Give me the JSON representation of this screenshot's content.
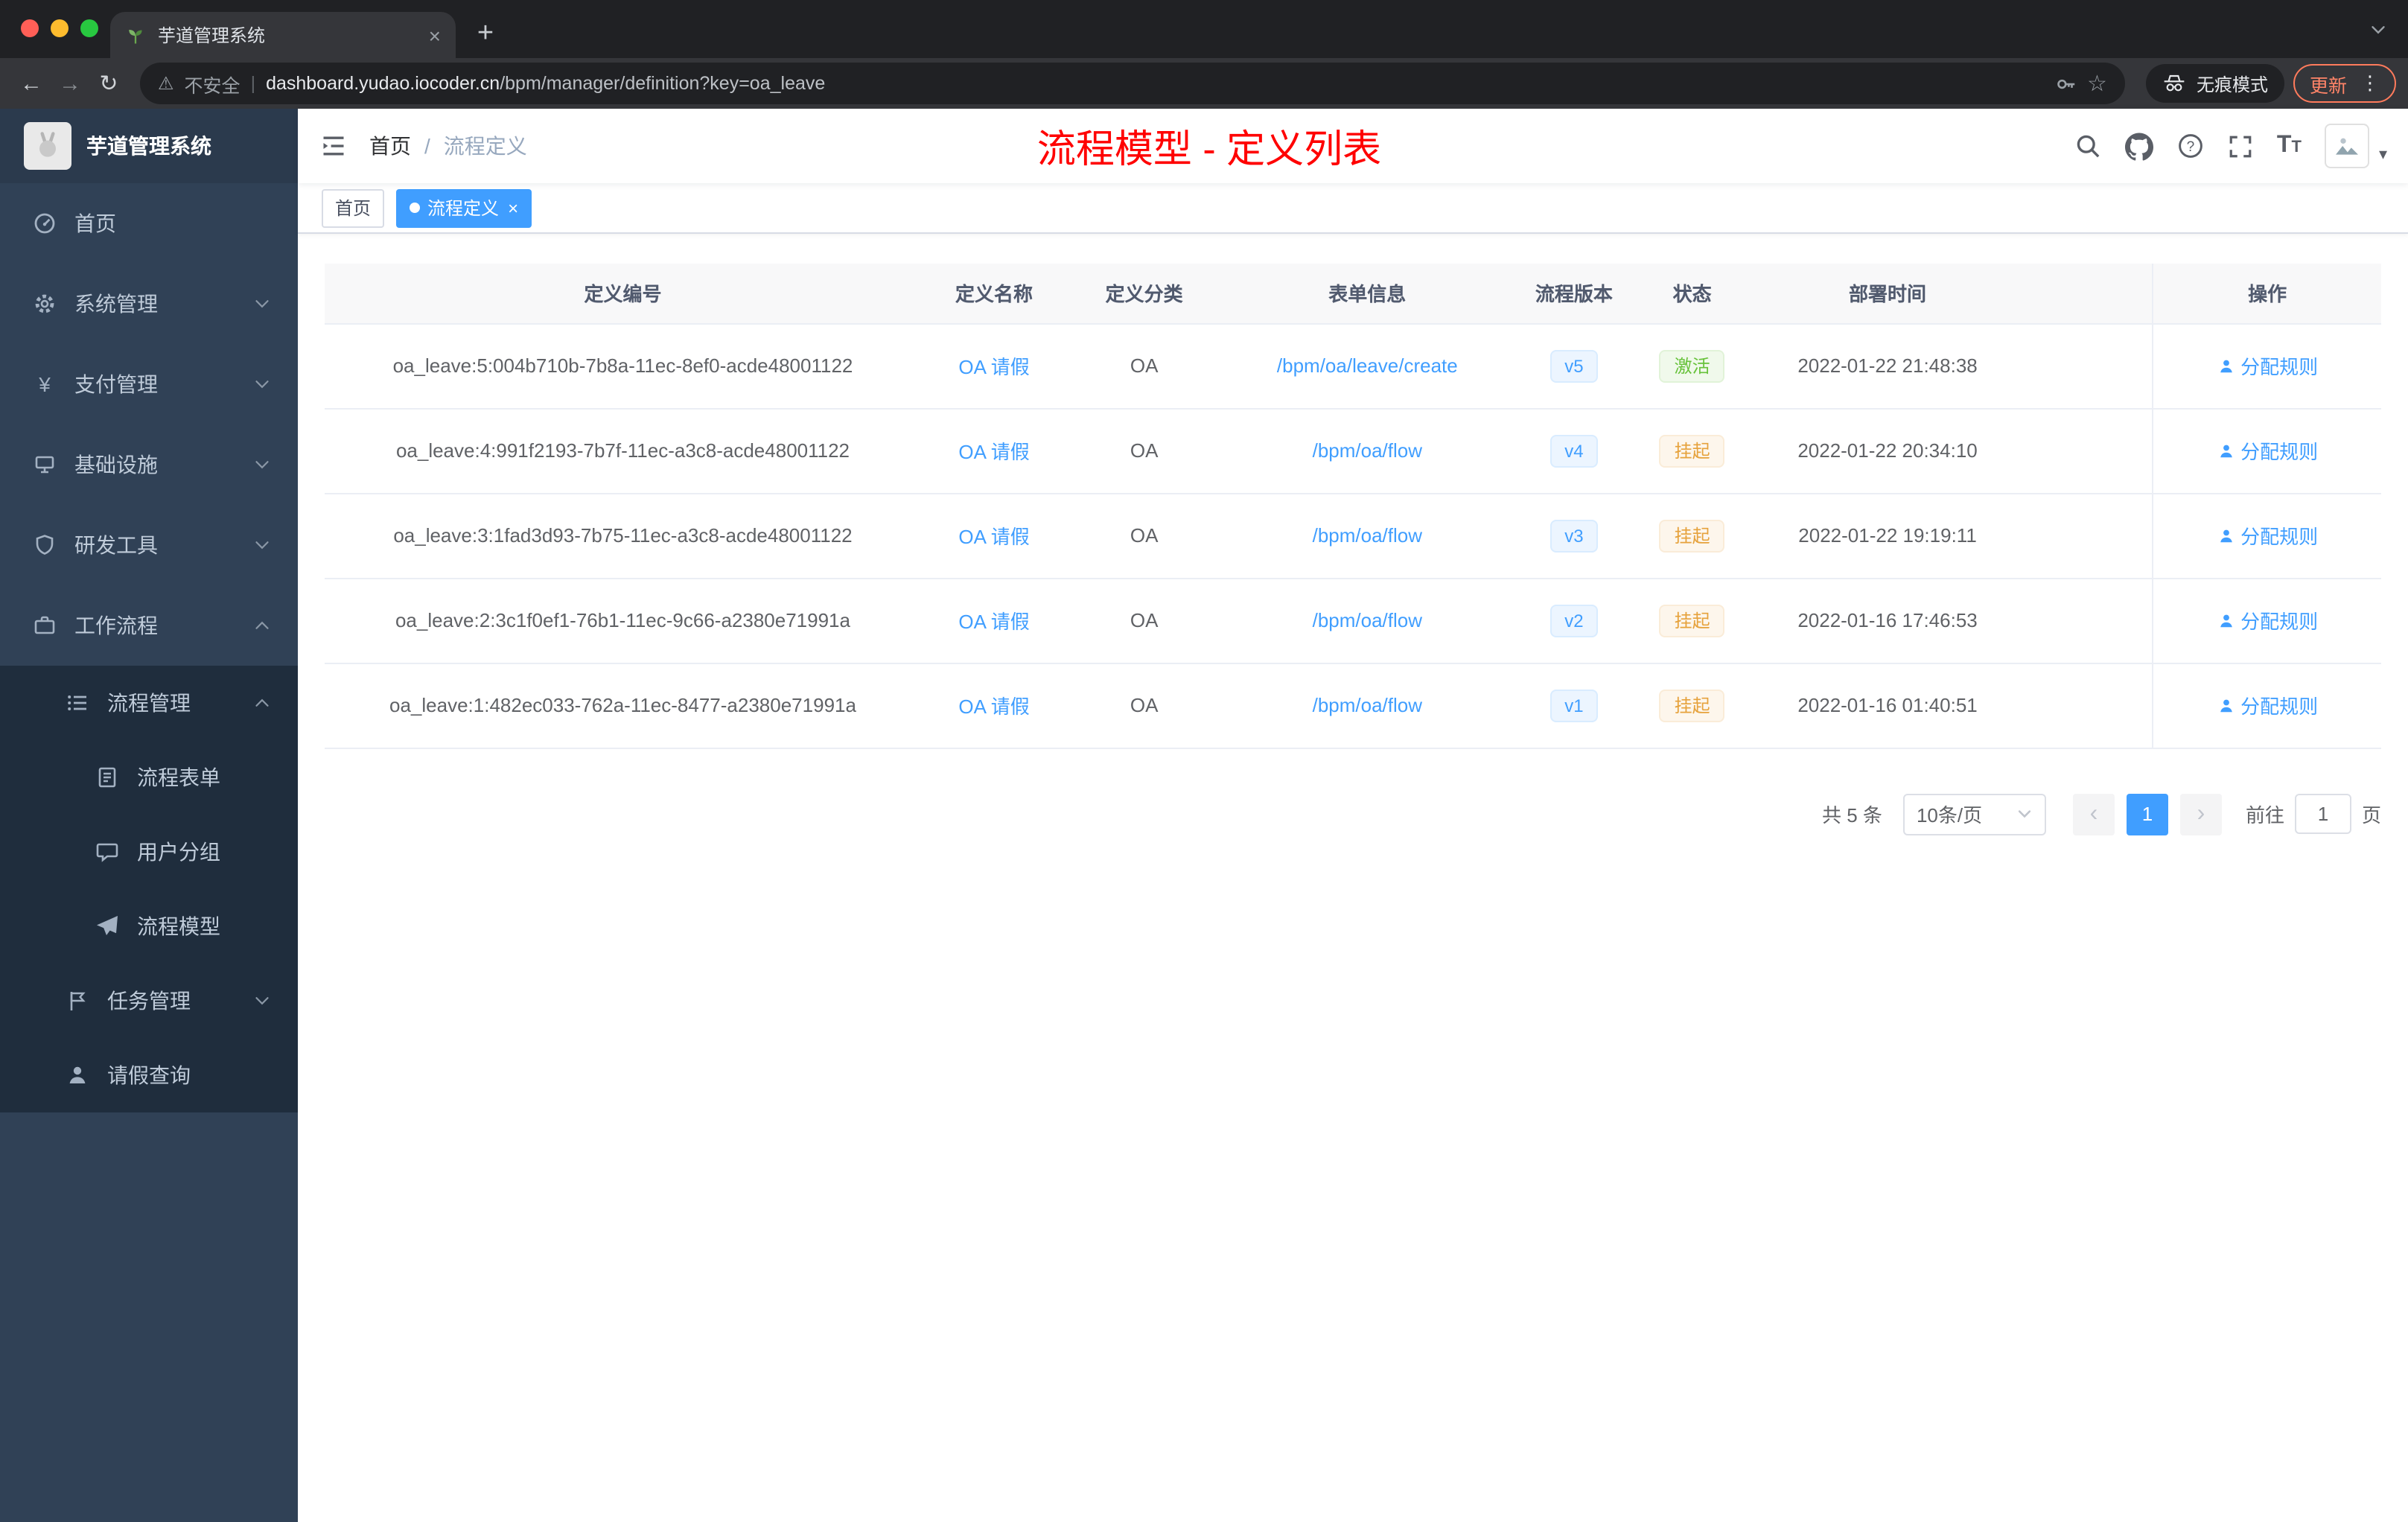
{
  "colors": {
    "accent": "#409eff",
    "page_title_red": "#ff0000",
    "status_active_green": "#67c23a",
    "status_suspended_orange": "#e6a23c",
    "sidebar_bg": "#304156",
    "sidebar_sub_bg": "#1f2d3d",
    "table_header_bg": "#f8f8f9"
  },
  "glyphs": {
    "back": "←",
    "forward": "→",
    "reload": "↻",
    "star": "☆",
    "more": "⋮",
    "warning": "⚠",
    "divider": "|",
    "new_tab": "+",
    "close": "×",
    "prev": "‹",
    "next": "›",
    "yen": "¥",
    "caret": "▾"
  },
  "browser": {
    "tab_title": "芋道管理系统",
    "security_label": "不安全",
    "url_domain": "dashboard.yudao.iocoder.cn",
    "url_path": "/bpm/manager/definition?key=oa_leave",
    "incognito_label": "无痕模式",
    "update_label": "更新"
  },
  "sidebar": {
    "logo_title": "芋道管理系统",
    "items": [
      {
        "label": "首页",
        "icon": "dashboard-icon"
      },
      {
        "label": "系统管理",
        "icon": "gear-icon"
      },
      {
        "label": "支付管理",
        "icon": "yen-icon"
      },
      {
        "label": "基础设施",
        "icon": "server-icon"
      },
      {
        "label": "研发工具",
        "icon": "shield-icon"
      },
      {
        "label": "工作流程",
        "icon": "briefcase-icon"
      },
      {
        "label": "流程管理",
        "icon": "list-icon"
      },
      {
        "label": "流程表单",
        "icon": "document-icon"
      },
      {
        "label": "用户分组",
        "icon": "chat-icon"
      },
      {
        "label": "流程模型",
        "icon": "send-icon"
      },
      {
        "label": "任务管理",
        "icon": "flag-icon"
      },
      {
        "label": "请假查询",
        "icon": "user-icon"
      }
    ]
  },
  "navbar": {
    "breadcrumb": {
      "home": "首页",
      "separator": "/",
      "current": "流程定义"
    },
    "page_title": "流程模型 - 定义列表",
    "font_icon_label": "T",
    "icons": [
      "search-icon",
      "github-icon",
      "help-icon",
      "fullscreen-icon",
      "font-size-icon",
      "avatar",
      "caret-down-icon"
    ]
  },
  "tags": {
    "home": "首页",
    "current": "流程定义"
  },
  "table": {
    "columns": [
      "定义编号",
      "定义名称",
      "定义分类",
      "表单信息",
      "流程版本",
      "状态",
      "部署时间",
      "操作"
    ],
    "action_label": "分配规则",
    "rows": [
      {
        "id": "oa_leave:5:004b710b-7b8a-11ec-8ef0-acde48001122",
        "name": "OA 请假",
        "category": "OA",
        "form": "/bpm/oa/leave/create",
        "version": "v5",
        "status": "激活",
        "status_type": "active",
        "deploy_time": "2022-01-22 21:48:38"
      },
      {
        "id": "oa_leave:4:991f2193-7b7f-11ec-a3c8-acde48001122",
        "name": "OA 请假",
        "category": "OA",
        "form": "/bpm/oa/flow",
        "version": "v4",
        "status": "挂起",
        "status_type": "suspended",
        "deploy_time": "2022-01-22 20:34:10"
      },
      {
        "id": "oa_leave:3:1fad3d93-7b75-11ec-a3c8-acde48001122",
        "name": "OA 请假",
        "category": "OA",
        "form": "/bpm/oa/flow",
        "version": "v3",
        "status": "挂起",
        "status_type": "suspended",
        "deploy_time": "2022-01-22 19:19:11"
      },
      {
        "id": "oa_leave:2:3c1f0ef1-76b1-11ec-9c66-a2380e71991a",
        "name": "OA 请假",
        "category": "OA",
        "form": "/bpm/oa/flow",
        "version": "v2",
        "status": "挂起",
        "status_type": "suspended",
        "deploy_time": "2022-01-16 17:46:53"
      },
      {
        "id": "oa_leave:1:482ec033-762a-11ec-8477-a2380e71991a",
        "name": "OA 请假",
        "category": "OA",
        "form": "/bpm/oa/flow",
        "version": "v1",
        "status": "挂起",
        "status_type": "suspended",
        "deploy_time": "2022-01-16 01:40:51"
      }
    ]
  },
  "pagination": {
    "total": "共 5 条",
    "page_size": "10条/页",
    "current_page": "1",
    "goto_label": "前往",
    "goto_value": "1",
    "page_unit": "页"
  }
}
